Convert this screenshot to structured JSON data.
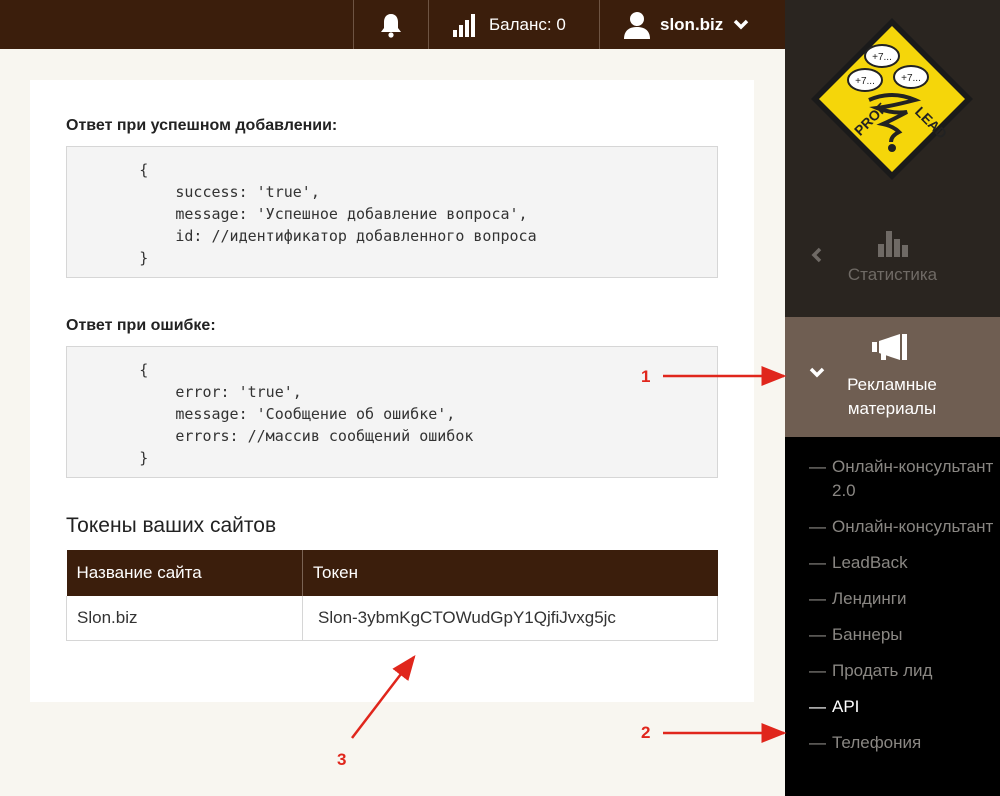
{
  "topbar": {
    "bell_icon": "bell-icon",
    "balance_label": "Баланс: 0",
    "signal_icon": "signal-bars-icon",
    "username": "slon.biz",
    "user_icon": "user-icon"
  },
  "sidebar": {
    "logo_text": [
      "+7...",
      "+7...",
      "+7...",
      "PROF",
      "LEAD"
    ],
    "stat_label": "Статистика",
    "ads_label": "Рекламные материалы",
    "sub_items": [
      {
        "label": "Онлайн-консультант 2.0"
      },
      {
        "label": "Онлайн-консультант"
      },
      {
        "label": "LeadBack"
      },
      {
        "label": "Лендинги"
      },
      {
        "label": "Баннеры"
      },
      {
        "label": "Продать лид"
      },
      {
        "label": "API"
      },
      {
        "label": "Телефония"
      }
    ],
    "dash": "—"
  },
  "content": {
    "success_heading": "Ответ при успешном добавлении:",
    "success_code": "        {\n            success: 'true',\n            message: 'Успешное добавление вопроса',\n            id: //идентификатор добавленного вопроса\n        }",
    "error_heading": "Ответ при ошибке:",
    "error_code": "        {\n            error: 'true',\n            message: 'Сообщение об ошибке',\n            errors: //массив сообщений ошибок\n        }",
    "tokens_heading": "Токены ваших сайтов",
    "table": {
      "headers": [
        "Название сайта",
        "Токен"
      ],
      "rows": [
        [
          "Slon.biz",
          "Slon-3ybmKgCTOWudGpY1QjfiJvxg5jc"
        ]
      ]
    }
  },
  "annotations": {
    "n1": "1",
    "n2": "2",
    "n3": "3",
    "color": "#e0261c"
  },
  "colors": {
    "topbar": "#3b1e0c",
    "sidebar_active": "#6f5e52",
    "logo_yellow": "#f5d60a"
  }
}
